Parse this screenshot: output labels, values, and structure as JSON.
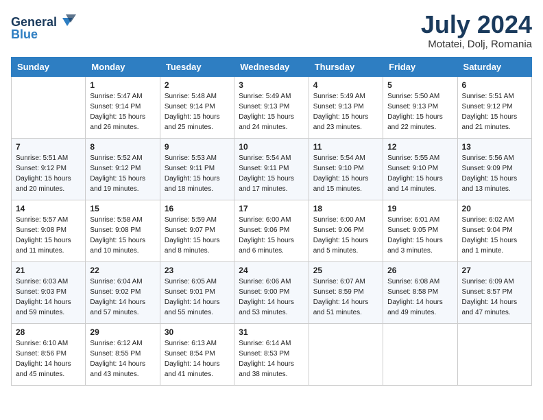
{
  "header": {
    "logo_general": "General",
    "logo_blue": "Blue",
    "month_title": "July 2024",
    "location": "Motatei, Dolj, Romania"
  },
  "days_of_week": [
    "Sunday",
    "Monday",
    "Tuesday",
    "Wednesday",
    "Thursday",
    "Friday",
    "Saturday"
  ],
  "weeks": [
    [
      {
        "day": "",
        "sunrise": "",
        "sunset": "",
        "daylight": ""
      },
      {
        "day": "1",
        "sunrise": "Sunrise: 5:47 AM",
        "sunset": "Sunset: 9:14 PM",
        "daylight": "Daylight: 15 hours and 26 minutes."
      },
      {
        "day": "2",
        "sunrise": "Sunrise: 5:48 AM",
        "sunset": "Sunset: 9:14 PM",
        "daylight": "Daylight: 15 hours and 25 minutes."
      },
      {
        "day": "3",
        "sunrise": "Sunrise: 5:49 AM",
        "sunset": "Sunset: 9:13 PM",
        "daylight": "Daylight: 15 hours and 24 minutes."
      },
      {
        "day": "4",
        "sunrise": "Sunrise: 5:49 AM",
        "sunset": "Sunset: 9:13 PM",
        "daylight": "Daylight: 15 hours and 23 minutes."
      },
      {
        "day": "5",
        "sunrise": "Sunrise: 5:50 AM",
        "sunset": "Sunset: 9:13 PM",
        "daylight": "Daylight: 15 hours and 22 minutes."
      },
      {
        "day": "6",
        "sunrise": "Sunrise: 5:51 AM",
        "sunset": "Sunset: 9:12 PM",
        "daylight": "Daylight: 15 hours and 21 minutes."
      }
    ],
    [
      {
        "day": "7",
        "sunrise": "Sunrise: 5:51 AM",
        "sunset": "Sunset: 9:12 PM",
        "daylight": "Daylight: 15 hours and 20 minutes."
      },
      {
        "day": "8",
        "sunrise": "Sunrise: 5:52 AM",
        "sunset": "Sunset: 9:12 PM",
        "daylight": "Daylight: 15 hours and 19 minutes."
      },
      {
        "day": "9",
        "sunrise": "Sunrise: 5:53 AM",
        "sunset": "Sunset: 9:11 PM",
        "daylight": "Daylight: 15 hours and 18 minutes."
      },
      {
        "day": "10",
        "sunrise": "Sunrise: 5:54 AM",
        "sunset": "Sunset: 9:11 PM",
        "daylight": "Daylight: 15 hours and 17 minutes."
      },
      {
        "day": "11",
        "sunrise": "Sunrise: 5:54 AM",
        "sunset": "Sunset: 9:10 PM",
        "daylight": "Daylight: 15 hours and 15 minutes."
      },
      {
        "day": "12",
        "sunrise": "Sunrise: 5:55 AM",
        "sunset": "Sunset: 9:10 PM",
        "daylight": "Daylight: 15 hours and 14 minutes."
      },
      {
        "day": "13",
        "sunrise": "Sunrise: 5:56 AM",
        "sunset": "Sunset: 9:09 PM",
        "daylight": "Daylight: 15 hours and 13 minutes."
      }
    ],
    [
      {
        "day": "14",
        "sunrise": "Sunrise: 5:57 AM",
        "sunset": "Sunset: 9:08 PM",
        "daylight": "Daylight: 15 hours and 11 minutes."
      },
      {
        "day": "15",
        "sunrise": "Sunrise: 5:58 AM",
        "sunset": "Sunset: 9:08 PM",
        "daylight": "Daylight: 15 hours and 10 minutes."
      },
      {
        "day": "16",
        "sunrise": "Sunrise: 5:59 AM",
        "sunset": "Sunset: 9:07 PM",
        "daylight": "Daylight: 15 hours and 8 minutes."
      },
      {
        "day": "17",
        "sunrise": "Sunrise: 6:00 AM",
        "sunset": "Sunset: 9:06 PM",
        "daylight": "Daylight: 15 hours and 6 minutes."
      },
      {
        "day": "18",
        "sunrise": "Sunrise: 6:00 AM",
        "sunset": "Sunset: 9:06 PM",
        "daylight": "Daylight: 15 hours and 5 minutes."
      },
      {
        "day": "19",
        "sunrise": "Sunrise: 6:01 AM",
        "sunset": "Sunset: 9:05 PM",
        "daylight": "Daylight: 15 hours and 3 minutes."
      },
      {
        "day": "20",
        "sunrise": "Sunrise: 6:02 AM",
        "sunset": "Sunset: 9:04 PM",
        "daylight": "Daylight: 15 hours and 1 minute."
      }
    ],
    [
      {
        "day": "21",
        "sunrise": "Sunrise: 6:03 AM",
        "sunset": "Sunset: 9:03 PM",
        "daylight": "Daylight: 14 hours and 59 minutes."
      },
      {
        "day": "22",
        "sunrise": "Sunrise: 6:04 AM",
        "sunset": "Sunset: 9:02 PM",
        "daylight": "Daylight: 14 hours and 57 minutes."
      },
      {
        "day": "23",
        "sunrise": "Sunrise: 6:05 AM",
        "sunset": "Sunset: 9:01 PM",
        "daylight": "Daylight: 14 hours and 55 minutes."
      },
      {
        "day": "24",
        "sunrise": "Sunrise: 6:06 AM",
        "sunset": "Sunset: 9:00 PM",
        "daylight": "Daylight: 14 hours and 53 minutes."
      },
      {
        "day": "25",
        "sunrise": "Sunrise: 6:07 AM",
        "sunset": "Sunset: 8:59 PM",
        "daylight": "Daylight: 14 hours and 51 minutes."
      },
      {
        "day": "26",
        "sunrise": "Sunrise: 6:08 AM",
        "sunset": "Sunset: 8:58 PM",
        "daylight": "Daylight: 14 hours and 49 minutes."
      },
      {
        "day": "27",
        "sunrise": "Sunrise: 6:09 AM",
        "sunset": "Sunset: 8:57 PM",
        "daylight": "Daylight: 14 hours and 47 minutes."
      }
    ],
    [
      {
        "day": "28",
        "sunrise": "Sunrise: 6:10 AM",
        "sunset": "Sunset: 8:56 PM",
        "daylight": "Daylight: 14 hours and 45 minutes."
      },
      {
        "day": "29",
        "sunrise": "Sunrise: 6:12 AM",
        "sunset": "Sunset: 8:55 PM",
        "daylight": "Daylight: 14 hours and 43 minutes."
      },
      {
        "day": "30",
        "sunrise": "Sunrise: 6:13 AM",
        "sunset": "Sunset: 8:54 PM",
        "daylight": "Daylight: 14 hours and 41 minutes."
      },
      {
        "day": "31",
        "sunrise": "Sunrise: 6:14 AM",
        "sunset": "Sunset: 8:53 PM",
        "daylight": "Daylight: 14 hours and 38 minutes."
      },
      {
        "day": "",
        "sunrise": "",
        "sunset": "",
        "daylight": ""
      },
      {
        "day": "",
        "sunrise": "",
        "sunset": "",
        "daylight": ""
      },
      {
        "day": "",
        "sunrise": "",
        "sunset": "",
        "daylight": ""
      }
    ]
  ]
}
